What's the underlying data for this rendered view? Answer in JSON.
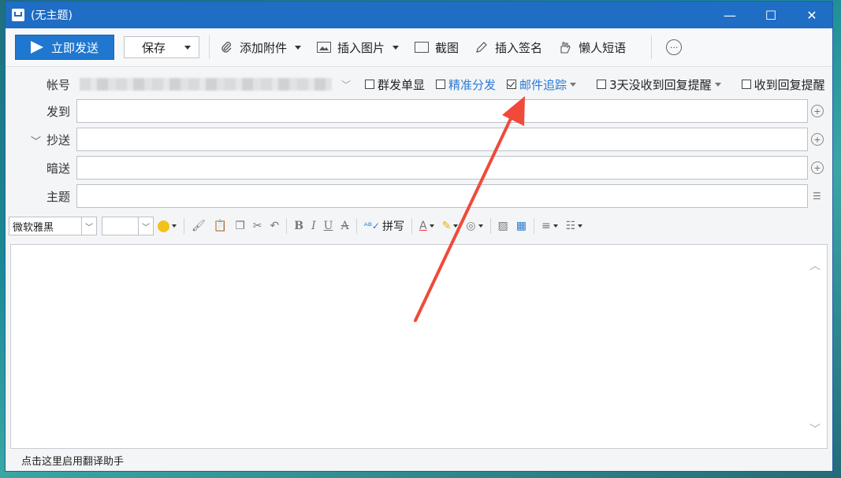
{
  "window": {
    "title": "(无主题)"
  },
  "toolbar": {
    "send_label": "立即发送",
    "save_label": "保存",
    "attach_label": "添加附件",
    "image_label": "插入图片",
    "screenshot_label": "截图",
    "signature_label": "插入签名",
    "phrases_label": "懒人短语"
  },
  "fields": {
    "account_label": "帐号",
    "to_label": "发到",
    "cc_label": "抄送",
    "bcc_label": "暗送",
    "subject_label": "主题"
  },
  "options": {
    "separate_send": "群发单显",
    "precise_send": "精准分发",
    "mail_tracking": "邮件追踪",
    "no_reply_reminder": "3天没收到回复提醒",
    "reply_reminder": "收到回复提醒"
  },
  "format": {
    "font": "微软雅黑",
    "spell": "拼写"
  },
  "status": {
    "text": "点击这里启用翻译助手"
  },
  "colors": {
    "accent": "#1f6dc4",
    "arrow": "#f04a3a"
  }
}
